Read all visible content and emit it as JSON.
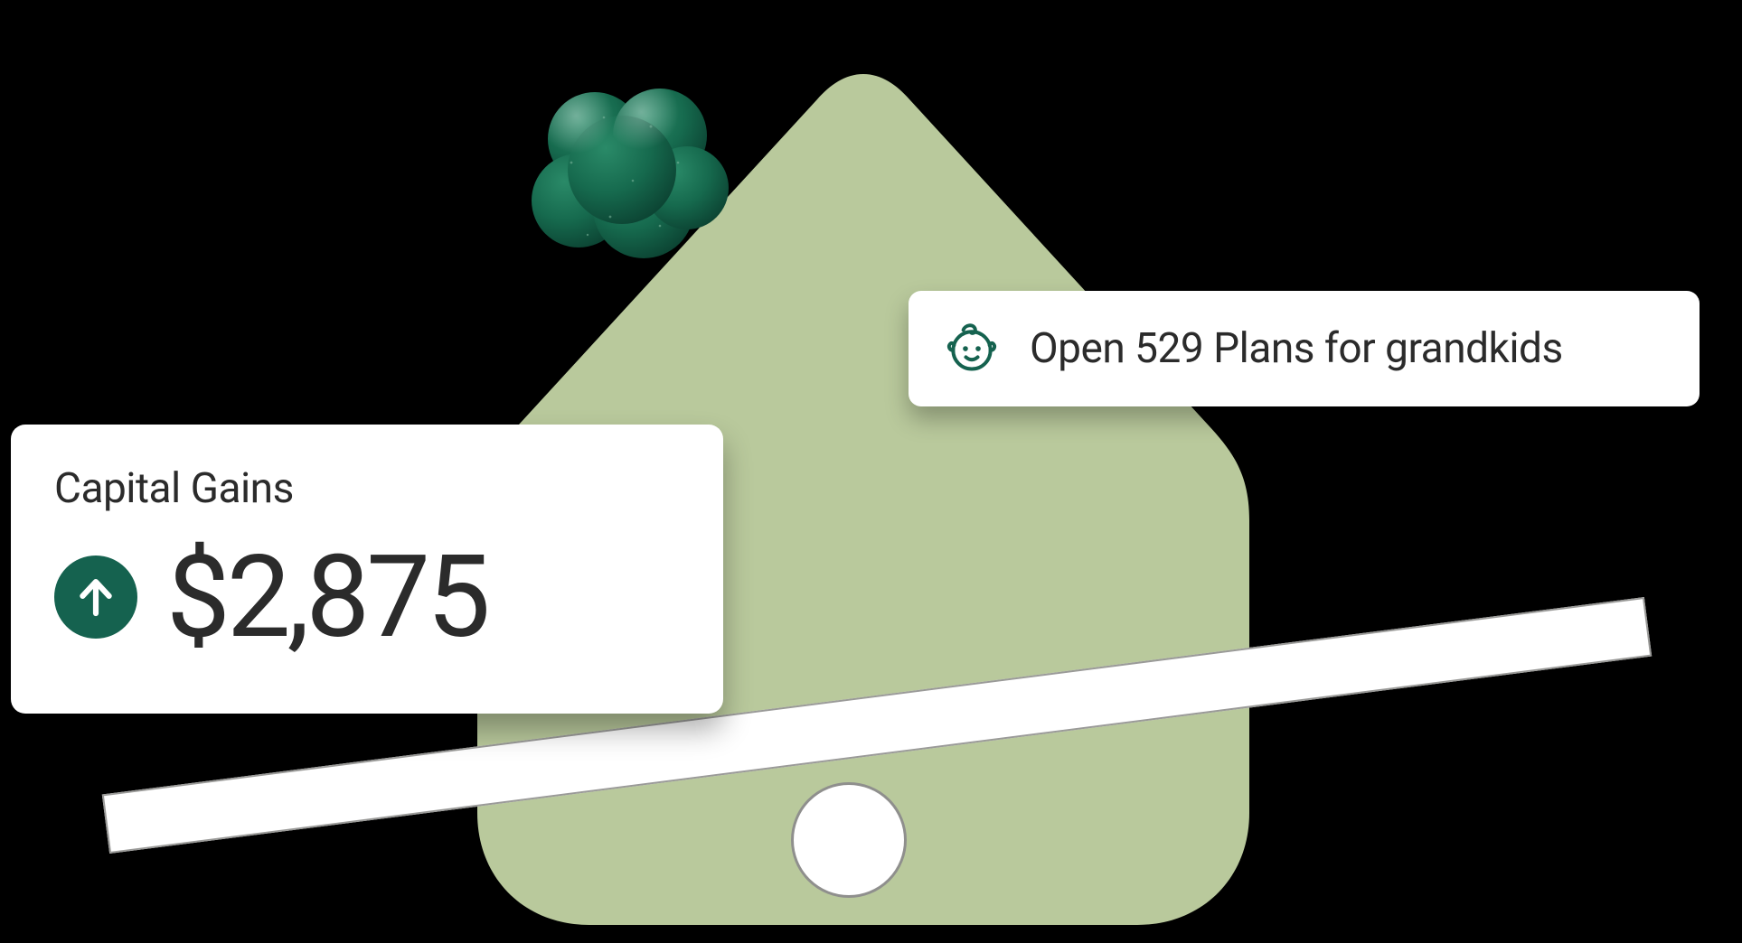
{
  "theme": {
    "house_fill": "#b9c99c",
    "accent_green": "#15624f",
    "blob_green": "#1b6a4f",
    "text_color": "#2b2b2b"
  },
  "cards": {
    "capital_gains": {
      "title": "Capital Gains",
      "amount": "$2,875",
      "direction_icon": "arrow-up"
    },
    "plan_529": {
      "icon": "baby-face",
      "label": "Open 529 Plans for grandkids"
    }
  }
}
